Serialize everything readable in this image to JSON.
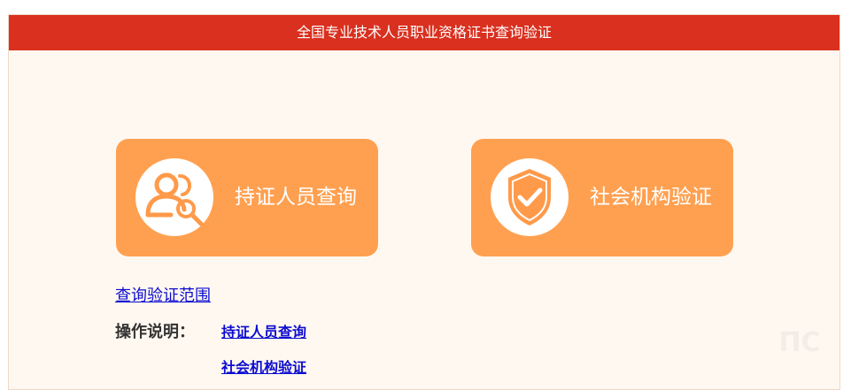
{
  "header": {
    "title": "全国专业技术人员职业资格证书查询验证"
  },
  "cards": {
    "holder_query": {
      "label": "持证人员查询",
      "icon": "people-search-icon"
    },
    "institution_verify": {
      "label": "社会机构验证",
      "icon": "shield-check-icon"
    }
  },
  "links": {
    "scope": "查询验证范围"
  },
  "instructions": {
    "label": "操作说明：",
    "items": [
      "持证人员查询",
      "社会机构验证"
    ]
  },
  "colors": {
    "header_bg": "#d9301f",
    "card_bg": "#ffa050",
    "page_bg": "#fff8f0",
    "link": "#0b0bd0"
  }
}
